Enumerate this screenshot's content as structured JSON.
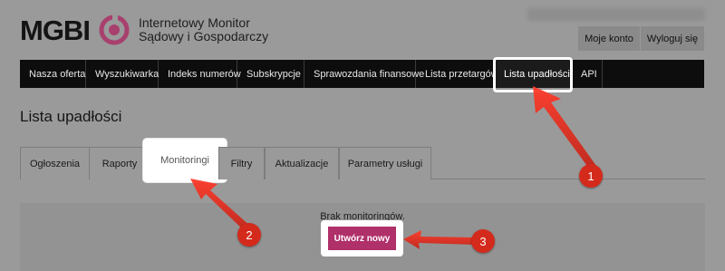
{
  "header": {
    "logo_word": "MGBI",
    "logo_line1": "Internetowy Monitor",
    "logo_line2": "Sądowy i Gospodarczy",
    "account_button": "Moje konto",
    "logout_button": "Wyloguj się"
  },
  "nav": {
    "items": [
      {
        "label": "Nasza oferta"
      },
      {
        "label": "Wyszukiwarka"
      },
      {
        "label": "Indeks numerów"
      },
      {
        "label": "Subskrypcje"
      },
      {
        "label": "Sprawozdania finansowe"
      },
      {
        "label": "Lista przetargów"
      },
      {
        "label": "Lista upadłości"
      },
      {
        "label": "API"
      }
    ],
    "active": "Lista upadłości"
  },
  "page": {
    "title": "Lista upadłości"
  },
  "tabs": {
    "items": [
      {
        "label": "Ogłoszenia"
      },
      {
        "label": "Raporty"
      },
      {
        "label": "Monitoringi"
      },
      {
        "label": "Filtry"
      },
      {
        "label": "Aktualizacje"
      },
      {
        "label": "Parametry usługi"
      }
    ],
    "active": "Monitoringi"
  },
  "content": {
    "empty_message": "Brak monitoringów.",
    "create_button": "Utwórz nowy"
  },
  "annotations": {
    "badges": [
      "1",
      "2",
      "3"
    ],
    "color": "#d42a1c"
  },
  "colors": {
    "brand": "#b0306a",
    "nav_bg": "#0d0d0d"
  }
}
